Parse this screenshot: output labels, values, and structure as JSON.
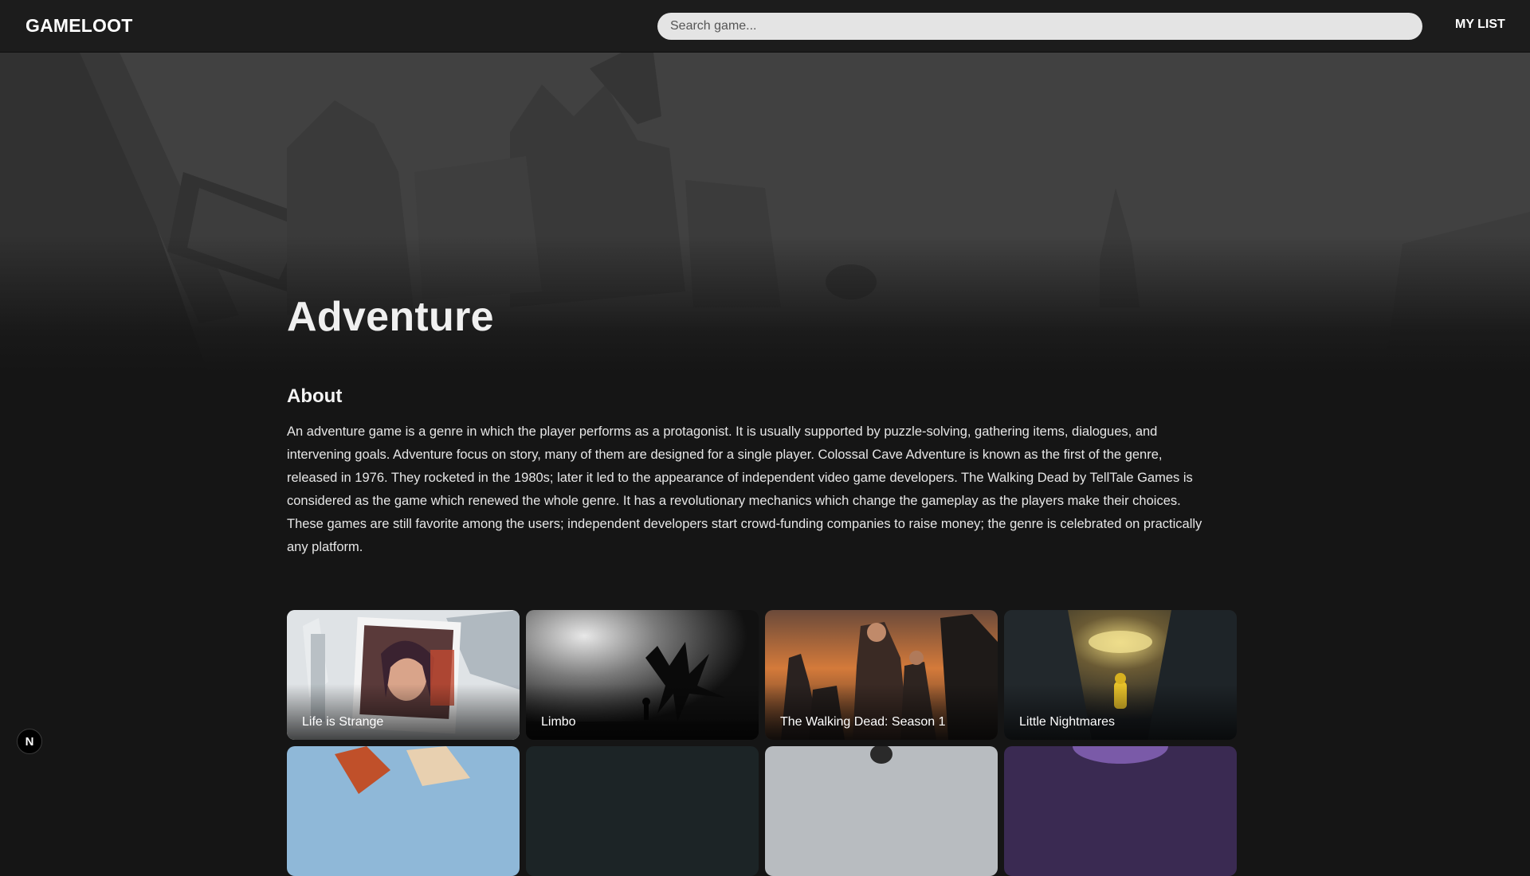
{
  "header": {
    "logo": "GAMELOOT",
    "search_placeholder": "Search game...",
    "search_value": "",
    "my_list_label": "MY LIST"
  },
  "genre": {
    "title": "Adventure",
    "about_heading": "About",
    "about_text": "An adventure game is a genre in which the player performs as a protagonist. It is usually supported by puzzle-solving, gathering items, dialogues, and intervening goals. Adventure focus on story, many of them are designed for a single player. Colossal Cave Adventure is known as the first of the genre, released in 1976. They rocketed in the 1980s; later it led to the appearance of independent video game developers. The Walking Dead by TellTale Games is considered as the game which renewed the whole genre. It has a revolutionary mechanics which change the gameplay as the players make their choices. These games are still favorite among the users; independent developers start crowd-funding companies to raise money; the genre is celebrated on practically any platform."
  },
  "games": [
    {
      "title": "Life is Strange"
    },
    {
      "title": "Limbo"
    },
    {
      "title": "The Walking Dead: Season 1"
    },
    {
      "title": "Little Nightmares"
    }
  ],
  "next_row_games": [
    {
      "title": ""
    },
    {
      "title": ""
    },
    {
      "title": ""
    },
    {
      "title": ""
    }
  ],
  "dev_badge": {
    "icon": "next-logo-icon",
    "glyph": "N"
  }
}
